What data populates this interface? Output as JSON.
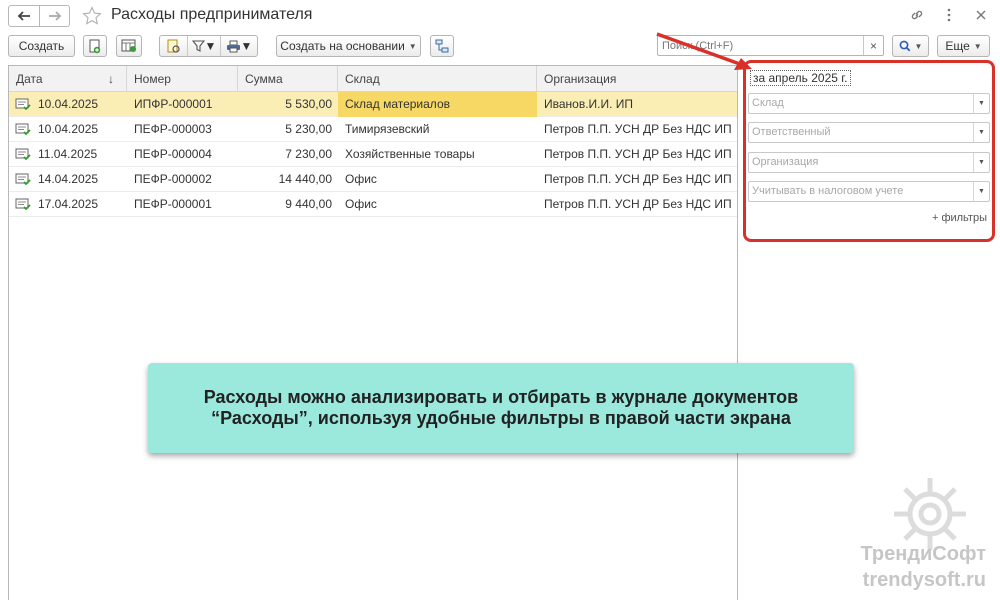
{
  "window": {
    "title": "Расходы предпринимателя"
  },
  "toolbar": {
    "create_label": "Создать",
    "create_based_label": "Создать на основании",
    "more_label": "Еще"
  },
  "search": {
    "placeholder": "Поиск (Ctrl+F)",
    "clear_label": "×"
  },
  "table": {
    "columns": [
      "Дата",
      "Номер",
      "Сумма",
      "Склад",
      "Организация"
    ],
    "sort_indicator": "↓",
    "rows": [
      {
        "date": "10.04.2025",
        "number": "ИПФР-000001",
        "sum": "5 530,00",
        "sklad": "Склад материалов",
        "org": "Иванов.И.И. ИП"
      },
      {
        "date": "10.04.2025",
        "number": "ПЕФР-000003",
        "sum": "5 230,00",
        "sklad": "Тимирязевский",
        "org": "Петров П.П. УСН ДР Без НДС ИП"
      },
      {
        "date": "11.04.2025",
        "number": "ПЕФР-000004",
        "sum": "7 230,00",
        "sklad": "Хозяйственные товары",
        "org": "Петров П.П. УСН ДР Без НДС ИП"
      },
      {
        "date": "14.04.2025",
        "number": "ПЕФР-000002",
        "sum": "14 440,00",
        "sklad": "Офис",
        "org": "Петров П.П. УСН ДР Без НДС ИП"
      },
      {
        "date": "17.04.2025",
        "number": "ПЕФР-000001",
        "sum": "9 440,00",
        "sklad": "Офис",
        "org": "Петров П.П. УСН ДР Без НДС ИП"
      }
    ]
  },
  "filters": {
    "period": "за апрель 2025 г.",
    "sklad_placeholder": "Склад",
    "responsible_placeholder": "Ответственный",
    "org_placeholder": "Организация",
    "tax_placeholder": "Учитывать в налоговом учете",
    "more_filters": "+ фильтры"
  },
  "caption": {
    "text": "Расходы можно анализировать и отбирать в журнале документов “Расходы”, используя удобные фильтры в правой части экрана"
  },
  "watermark": {
    "brand": "ТрендиСофт",
    "site": "trendysoft.ru"
  },
  "colors": {
    "selected_row": "#fbeeb5",
    "selected_cell": "#f7d865",
    "highlight_red": "#d9302a",
    "caption_bg": "#9be9dd"
  }
}
